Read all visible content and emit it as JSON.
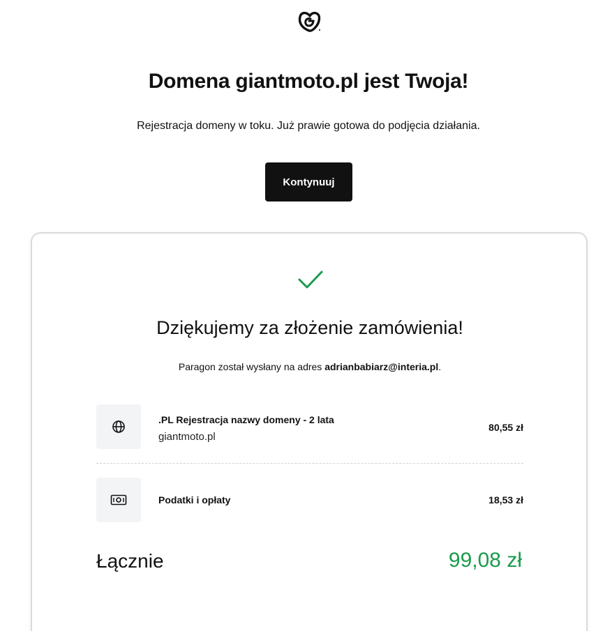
{
  "logo": {
    "icon": "godaddy-logo-icon"
  },
  "hero": {
    "headline": "Domena giantmoto.pl jest Twoja!",
    "subline": "Rejestracja domeny w toku. Już prawie gotowa do podjęcia działania.",
    "continue_label": "Kontynuuj"
  },
  "order": {
    "check_icon": "checkmark-icon",
    "check_color": "#1a9c4b",
    "thanks": "Dziękujemy za złożenie zamówienia!",
    "receipt_prefix": "Paragon został wysłany na adres ",
    "receipt_email": "adrianbabiarz@interia.pl",
    "receipt_suffix": ".",
    "items": [
      {
        "icon": "globe-icon",
        "title": ".PL Rejestracja nazwy domeny - 2 lata",
        "subtitle": "giantmoto.pl",
        "price": "80,55 zł"
      },
      {
        "icon": "money-bill-icon",
        "title": "Podatki i opłaty",
        "price": "18,53 zł"
      }
    ],
    "total_label": "Łącznie",
    "total_value": "99,08 zł",
    "total_color": "#1a9c4b"
  }
}
